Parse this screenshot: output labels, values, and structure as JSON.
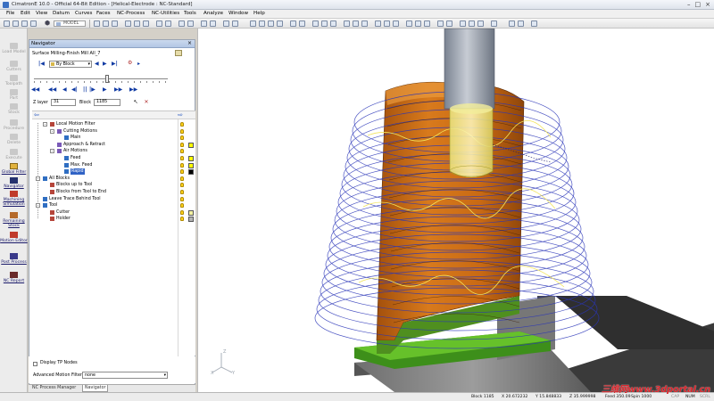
{
  "window": {
    "title": "CimatronE 10.0 - Official 64-Bit Edition - [Helical-Electrode : NC-Standard]",
    "controls": [
      "–",
      "□",
      "×"
    ]
  },
  "menu": [
    "File",
    "Edit",
    "View",
    "Datum",
    "Curves",
    "Faces",
    "NC-Process",
    "NC-Utilities",
    "Tools",
    "Analyze",
    "Window",
    "Help"
  ],
  "toolbar": {
    "model_label": "MODEL"
  },
  "left_toolbar": [
    {
      "label": "Load Model",
      "enabled": false
    },
    {
      "label": "Cutters",
      "enabled": false
    },
    {
      "label": "Toolpath",
      "enabled": false
    },
    {
      "label": "Part",
      "enabled": false
    },
    {
      "label": "Stock",
      "enabled": false
    },
    {
      "label": "Procedure",
      "enabled": false
    },
    {
      "label": "Delete",
      "enabled": false
    },
    {
      "label": "Execute",
      "enabled": false
    },
    {
      "label": "Global Filter",
      "enabled": true
    },
    {
      "label": "Navigator",
      "enabled": true
    },
    {
      "label": "Machining Simulation",
      "enabled": true
    },
    {
      "label": "Remaining Stock",
      "enabled": true
    },
    {
      "label": "Motion Editor",
      "enabled": true
    },
    {
      "label": "Post Process",
      "enabled": true
    },
    {
      "label": "NC Report",
      "enabled": true
    }
  ],
  "navigator": {
    "title": "Navigator",
    "close": "×",
    "operation": "Surface Milling-Finish Mill All_7",
    "mode": "By Block",
    "z_layer_label": "Z layer",
    "z_layer_value": "31",
    "block_label": "Block",
    "block_value": "1185",
    "tree": [
      {
        "label": "Local Motion Filter",
        "level": 1,
        "expander": "-",
        "bulb": true
      },
      {
        "label": "Cutting Motions",
        "level": 2,
        "expander": "-",
        "bulb": true
      },
      {
        "label": "Main",
        "level": 3,
        "expander": "",
        "bulb": true
      },
      {
        "label": "Approach & Retract",
        "level": 2,
        "expander": "",
        "bulb": true,
        "swatch": "#ffff00"
      },
      {
        "label": "Air Motions",
        "level": 2,
        "expander": "-",
        "bulb": true
      },
      {
        "label": "Feed",
        "level": 3,
        "expander": "",
        "bulb": true,
        "swatch": "#ffff00"
      },
      {
        "label": "Max. Feed",
        "level": 3,
        "expander": "",
        "bulb": true,
        "swatch": "#ffff00"
      },
      {
        "label": "Rapid",
        "level": 3,
        "expander": "",
        "bulb": true,
        "swatch": "#000000",
        "selected": true
      },
      {
        "label": "All Blocks",
        "level": 0,
        "expander": "-",
        "bulb": true
      },
      {
        "label": "Blocks up to Tool",
        "level": 1,
        "expander": "",
        "bulb": true
      },
      {
        "label": "Blocks from Tool to End",
        "level": 1,
        "expander": "",
        "bulb": true
      },
      {
        "label": "Leave Trace Behind Tool",
        "level": 0,
        "expander": "",
        "bulb": true
      },
      {
        "label": "Tool",
        "level": 0,
        "expander": "-",
        "bulb": true
      },
      {
        "label": "Cutter",
        "level": 1,
        "expander": "",
        "bulb": true,
        "swatch": "#f2f0a0"
      },
      {
        "label": "Holder",
        "level": 1,
        "expander": "",
        "bulb": true,
        "swatch": "#b4b4b4"
      }
    ],
    "display_tp_nodes": "Display TP Nodes",
    "advanced_motion_filter_label": "Advanced Motion Filter",
    "advanced_motion_filter_value": "none"
  },
  "tabs": [
    "NC Process Manager",
    "Navigator"
  ],
  "active_tab": 1,
  "triad": {
    "x": "X",
    "y": "Y",
    "z": "Z"
  },
  "status": {
    "block": "Block 1185",
    "x": "X 20.672232",
    "y": "Y 15.848833",
    "z": "Z 35.999998",
    "feed": "Feed 350.09",
    "spin": "Spin 1000",
    "caps": "CAP",
    "num": "NUM",
    "scrl": "SCRL"
  },
  "watermark": "三维网www.3dportal.cn"
}
